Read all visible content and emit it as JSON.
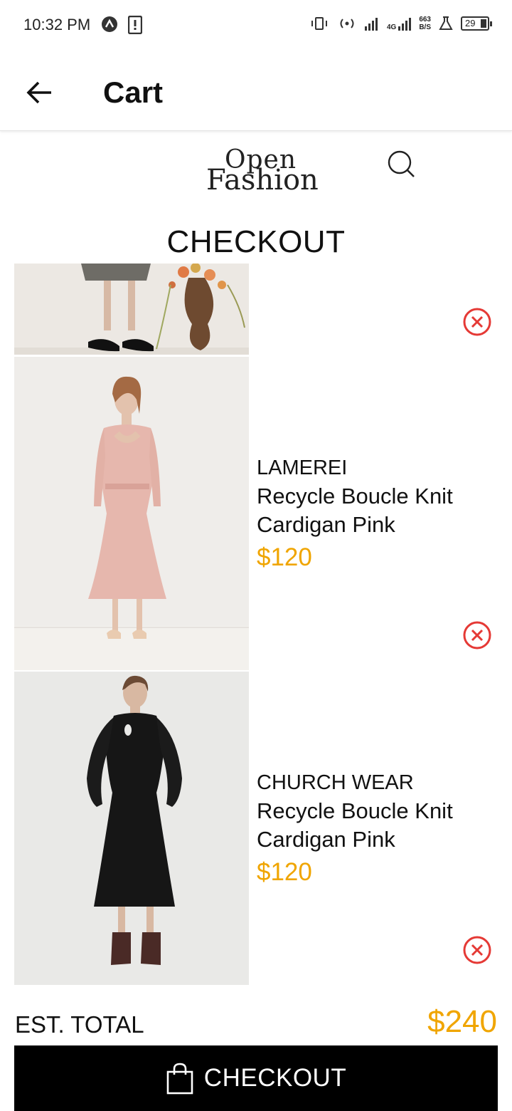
{
  "status_bar": {
    "time": "10:32 PM",
    "network_type": "4G",
    "net_speed_value": "663",
    "net_speed_unit": "B/S",
    "battery_level": "29"
  },
  "app_bar": {
    "title": "Cart",
    "back_icon": "arrow-left-icon"
  },
  "brand": {
    "logo_line1": "Open",
    "logo_line2": "Fashion",
    "search_icon": "search-icon"
  },
  "page": {
    "heading": "CHECKOUT"
  },
  "cart": {
    "items": [
      {
        "brand": "",
        "name": "",
        "price": "",
        "image": "black-dress-legs-with-flowers"
      },
      {
        "brand": "LAMEREI",
        "name": "Recycle Boucle Knit Cardigan Pink",
        "price": "$120",
        "image": "pink-midi-dress"
      },
      {
        "brand": "CHURCH WEAR",
        "name": "Recycle Boucle Knit Cardigan Pink",
        "price": "$120",
        "image": "black-midi-dress"
      }
    ]
  },
  "summary": {
    "total_label": "EST. TOTAL",
    "total_value": "$240"
  },
  "checkout_button": {
    "label": "CHECKOUT",
    "icon": "shopping-bag-icon"
  },
  "colors": {
    "accent": "#f0a500",
    "remove": "#e53935",
    "button_bg": "#000000"
  }
}
